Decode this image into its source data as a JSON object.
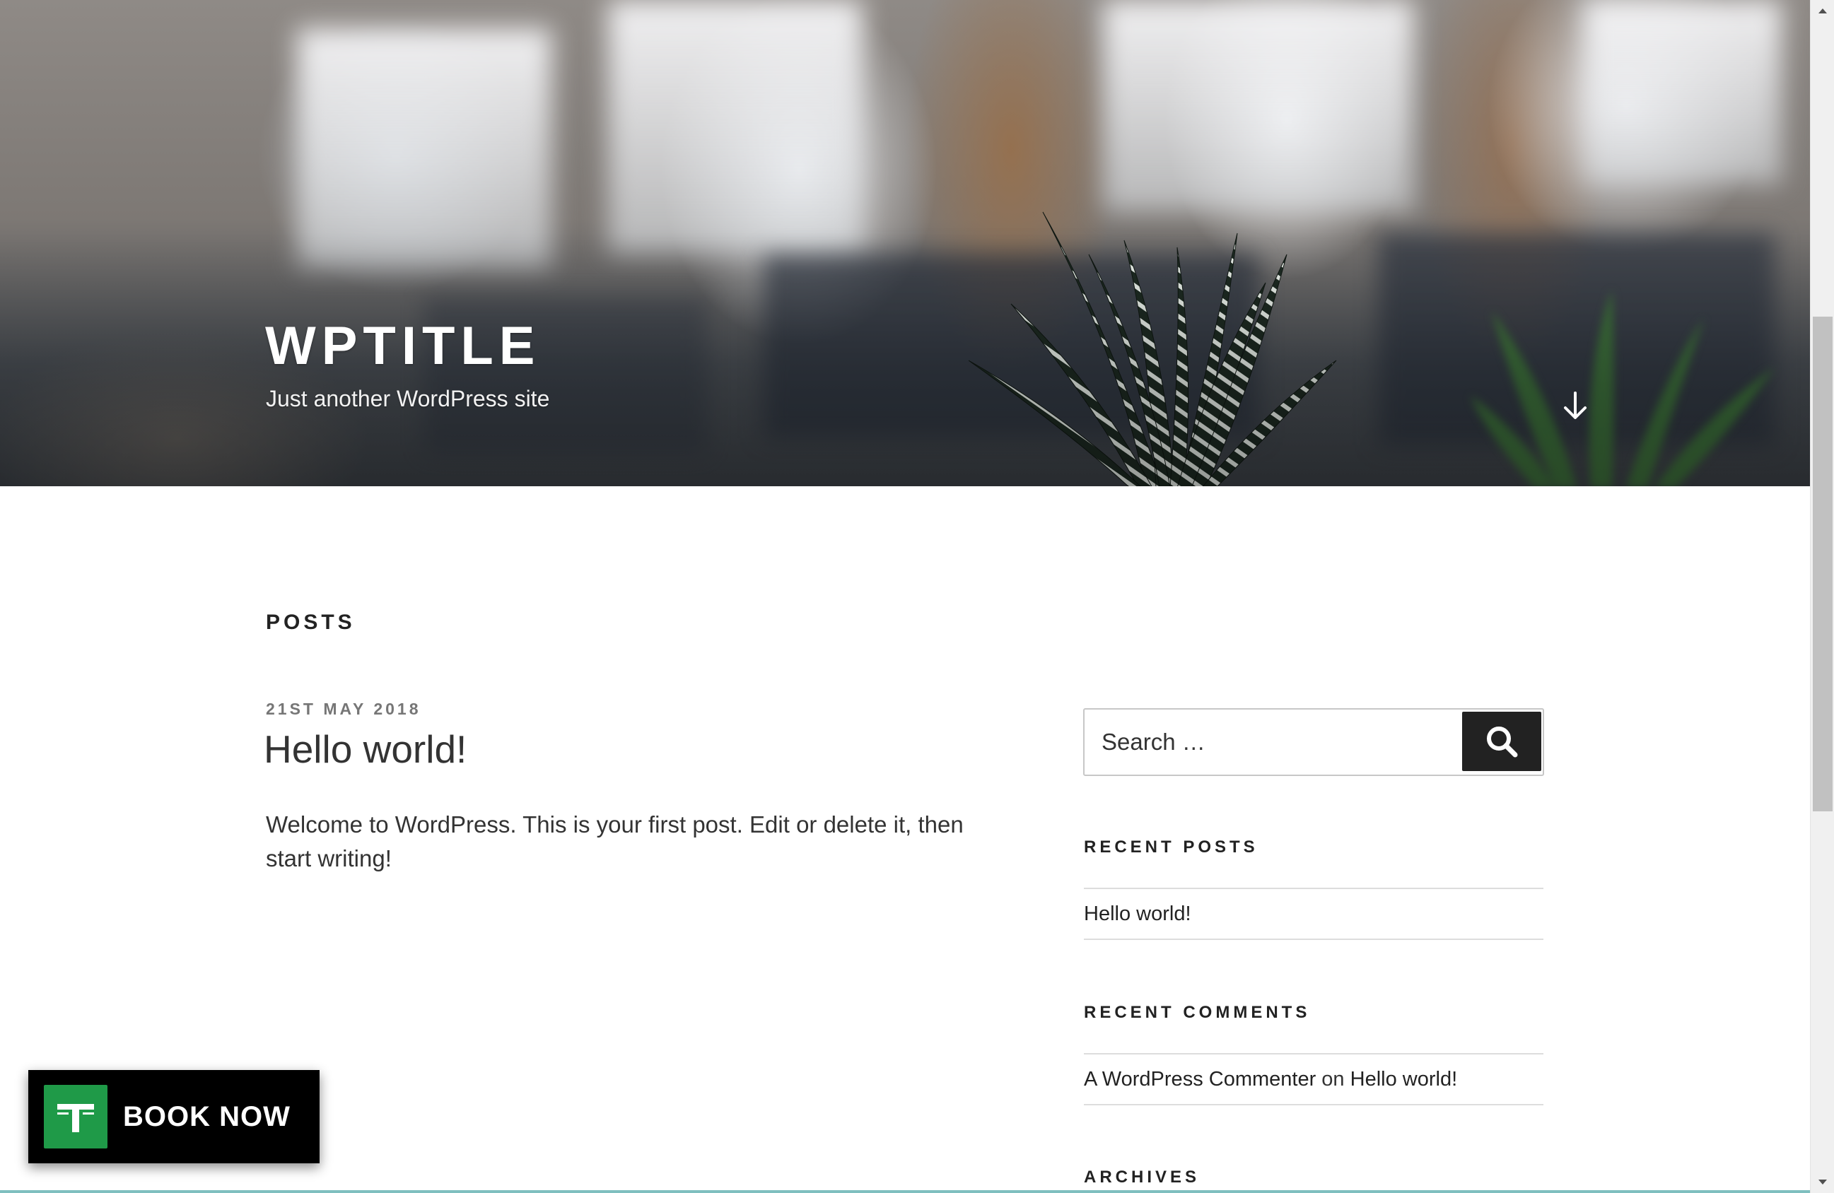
{
  "header": {
    "site_title": "WPTITLE",
    "site_description": "Just another WordPress site",
    "scroll_icon": "arrow-down-icon"
  },
  "main": {
    "section_heading": "POSTS",
    "post": {
      "date": "21ST MAY 2018",
      "title": "Hello world!",
      "excerpt": "Welcome to WordPress. This is your first post. Edit or delete it, then start writing!"
    }
  },
  "sidebar": {
    "search": {
      "placeholder": "Search …",
      "button_icon": "search-icon"
    },
    "recent_posts": {
      "title": "RECENT POSTS",
      "items": [
        "Hello world!"
      ]
    },
    "recent_comments": {
      "title": "RECENT COMMENTS",
      "items": [
        {
          "author": "A WordPress Commenter",
          "connector": "on",
          "post": "Hello world!"
        }
      ]
    },
    "archives": {
      "title": "ARCHIVES"
    }
  },
  "book_now": {
    "label": "BOOK NOW",
    "logo_icon": "t-logo-icon",
    "logo_color": "#1f9a48"
  },
  "colors": {
    "search_button": "#222222",
    "text": "#222222",
    "meta": "#767676"
  }
}
